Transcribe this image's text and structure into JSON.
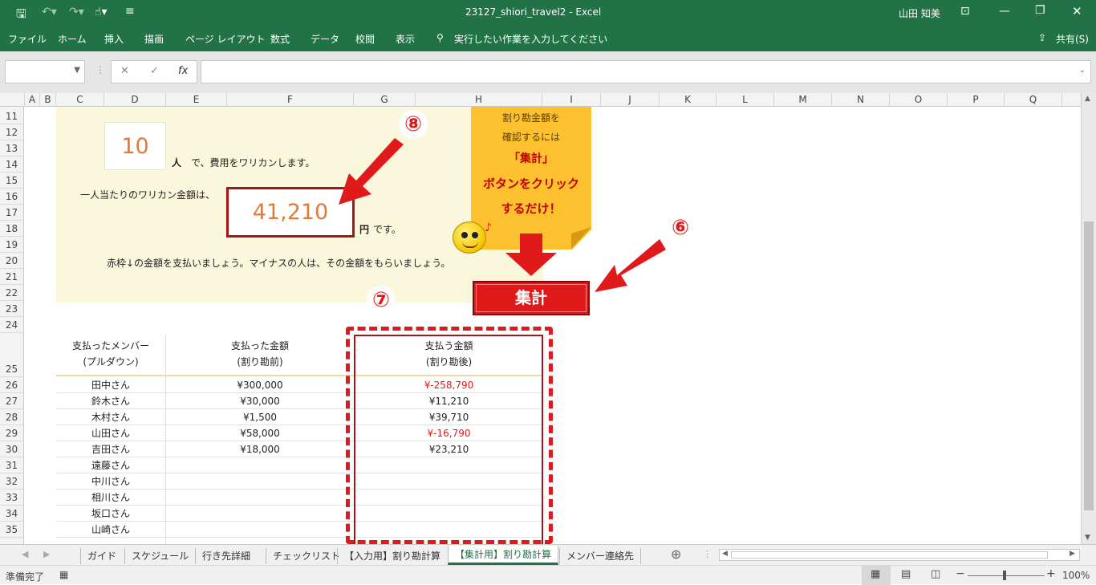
{
  "window": {
    "title": "23127_shiori_travel2  -  Excel",
    "user": "山田 知美"
  },
  "ribbon": {
    "tabs": [
      "ファイル",
      "ホーム",
      "挿入",
      "描画",
      "ページ レイアウト",
      "数式",
      "データ",
      "校閲",
      "表示"
    ],
    "search_placeholder": "実行したい作業を入力してください",
    "share": "共有(S)"
  },
  "formula": {
    "fx": "fx",
    "cancel": "✕",
    "confirm": "✓"
  },
  "columns": [
    "A",
    "B",
    "C",
    "D",
    "E",
    "F",
    "G",
    "H",
    "I",
    "J",
    "K",
    "L",
    "M",
    "N",
    "O",
    "P",
    "Q"
  ],
  "rows": [
    "11",
    "12",
    "13",
    "14",
    "15",
    "16",
    "17",
    "18",
    "19",
    "20",
    "21",
    "22",
    "23",
    "24",
    "25",
    "26",
    "27",
    "28",
    "29",
    "30",
    "31",
    "32",
    "33",
    "34",
    "35"
  ],
  "sheet": {
    "people_count": "10",
    "people_suffix": "人",
    "people_text": "で、費用をワリカンします。",
    "per_person_label": "一人当たりのワリカン金額は、",
    "per_person_amount": "41,210",
    "yen": "円",
    "desu": "です。",
    "instruction": "赤枠↓の金額を支払いましょう。マイナスの人は、その金額をもらいましょう。",
    "note": {
      "line1": "割り勘金額を",
      "line2": "確認するには",
      "line3": "「集計」",
      "line4": "ボタンをクリック",
      "line5": "するだけ！"
    },
    "calc_button": "集計",
    "callouts": {
      "six": "⑥",
      "seven": "⑦",
      "eight": "⑧"
    }
  },
  "table": {
    "headers": [
      {
        "line1": "支払ったメンバー",
        "line2": "(プルダウン)"
      },
      {
        "line1": "支払った金額",
        "line2": "(割り勘前)"
      },
      {
        "line1": "支払う金額",
        "line2": "(割り勘後)"
      }
    ],
    "rows": [
      {
        "name": "田中さん",
        "paid": "¥300,000",
        "owe": "¥-258,790",
        "negative": true
      },
      {
        "name": "鈴木さん",
        "paid": "¥30,000",
        "owe": "¥11,210",
        "negative": false
      },
      {
        "name": "木村さん",
        "paid": "¥1,500",
        "owe": "¥39,710",
        "negative": false
      },
      {
        "name": "山田さん",
        "paid": "¥58,000",
        "owe": "¥-16,790",
        "negative": true
      },
      {
        "name": "吉田さん",
        "paid": "¥18,000",
        "owe": "¥23,210",
        "negative": false
      },
      {
        "name": "遠藤さん",
        "paid": "",
        "owe": "",
        "negative": false
      },
      {
        "name": "中川さん",
        "paid": "",
        "owe": "",
        "negative": false
      },
      {
        "name": "相川さん",
        "paid": "",
        "owe": "",
        "negative": false
      },
      {
        "name": "坂口さん",
        "paid": "",
        "owe": "",
        "negative": false
      },
      {
        "name": "山崎さん",
        "paid": "",
        "owe": "",
        "negative": false
      }
    ]
  },
  "sheet_tabs": [
    "ガイド",
    "スケジュール",
    "行き先詳細",
    "チェックリスト",
    "【入力用】割り勘計算",
    "【集計用】割り勘計算",
    "メンバー連絡先"
  ],
  "active_tab": "【集計用】割り勘計算",
  "status": {
    "ready": "準備完了",
    "zoom": "100%"
  },
  "colors": {
    "excel_green": "#217346",
    "accent_red": "#e01a1a",
    "note_yellow": "#fdc02f",
    "sheet_yellow": "#fbf7dc"
  }
}
